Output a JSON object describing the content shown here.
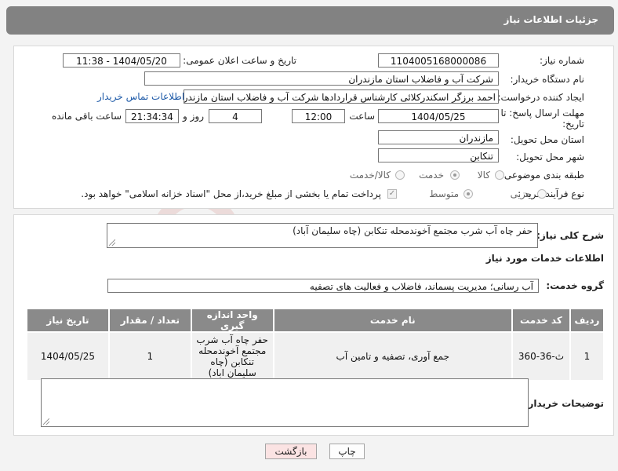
{
  "header": {
    "title": "جزئیات اطلاعات نیاز"
  },
  "form": {
    "need_number_label": "شماره نیاز:",
    "need_number": "1104005168000086",
    "announce_label": "تاریخ و ساعت اعلان عمومی:",
    "announce_value": "1404/05/20 - 11:38",
    "buyer_org_label": "نام دستگاه خریدار:",
    "buyer_org": "شرکت آب و فاضلاب استان مازندران",
    "creator_label": "ایجاد کننده درخواست:",
    "creator": "احمد برزگر اسکندرکلائی کارشناس قراردادها شرکت آب و فاضلاب استان مازندران",
    "contact_link": "اطلاعات تماس خریدار",
    "deadline_label_1": "مهلت ارسال پاسخ: تا",
    "deadline_label_2": "تاریخ:",
    "deadline_date": "1404/05/25",
    "time_label": "ساعت",
    "deadline_time": "12:00",
    "days_value": "4",
    "days_label": "روز و",
    "remaining_time": "21:34:34",
    "remaining_label": "ساعت باقی مانده",
    "province_label": "استان محل تحویل:",
    "province": "مازندران",
    "city_label": "شهر محل تحویل:",
    "city": "تنکابن",
    "category_label": "طبقه بندی موضوعی:",
    "category_options": [
      "کالا",
      "خدمت",
      "کالا/خدمت"
    ],
    "category_selected": "خدمت",
    "process_label": "نوع فرآیند خرید :",
    "process_options": [
      "جزیی",
      "متوسط"
    ],
    "process_selected": "متوسط",
    "payment_note": "پرداخت تمام یا بخشی از مبلغ خرید،از محل \"اسناد خزانه اسلامی\" خواهد بود."
  },
  "description": {
    "label": "شرح کلی نیاز:",
    "value": "حفر چاه آب شرب مجتمع آخوندمحله تنکابن (چاه سلیمان آباد)"
  },
  "services": {
    "title": "اطلاعات خدمات مورد نیاز",
    "group_label": "گروه خدمت:",
    "group_value": "آب رسانی؛ مدیریت پسماند، فاضلاب و فعالیت های تصفیه",
    "columns": [
      "ردیف",
      "کد خدمت",
      "نام خدمت",
      "واحد اندازه گیری",
      "تعداد / مقدار",
      "تاریخ نیاز"
    ],
    "rows": [
      {
        "row": "1",
        "code": "ث-36-360",
        "name": "جمع آوری، تصفیه و تامین آب",
        "unit": "حفر چاه آب شرب مجتمع آخوندمحله تنکابن (چاه سلیمان اباد)",
        "qty": "1",
        "date": "1404/05/25"
      }
    ]
  },
  "buyer_notes": {
    "label": "توضیحات خریدار:",
    "value": ""
  },
  "buttons": {
    "print": "چاپ",
    "back": "بازگشت"
  },
  "watermark": {
    "text": "AriaTender.neT"
  },
  "colors": {
    "header_bg": "#828282",
    "link": "#1e5aa8",
    "back_btn_bg": "#fbe3e3"
  }
}
